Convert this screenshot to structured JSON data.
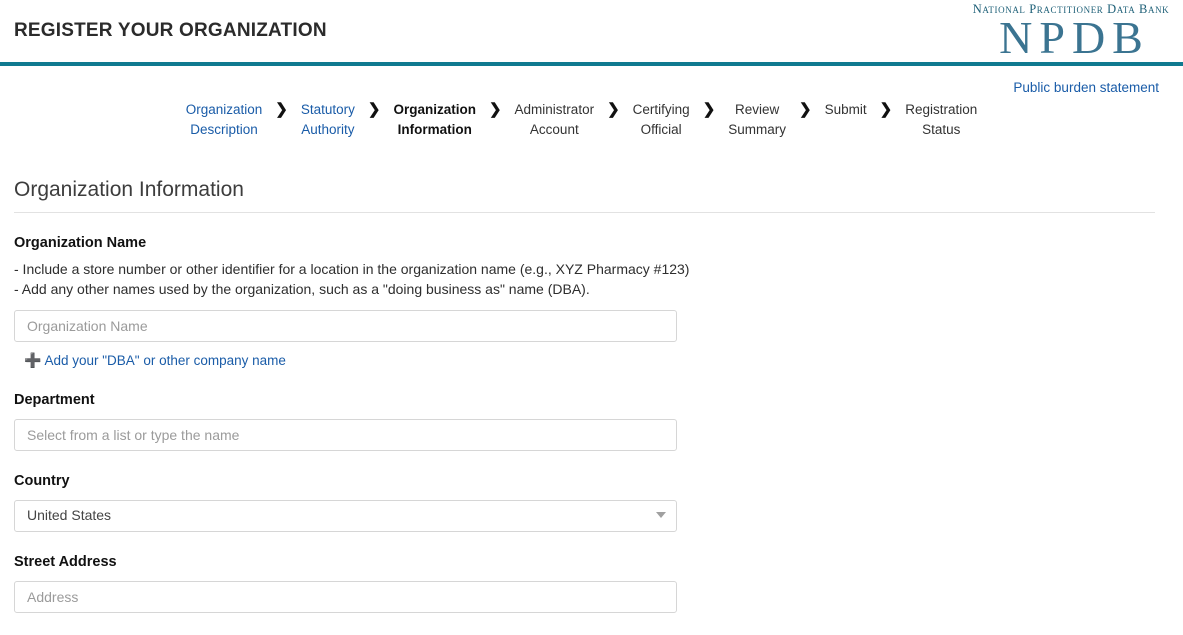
{
  "header": {
    "title": "REGISTER YOUR ORGANIZATION",
    "logo_caption": "National Practitioner Data Bank",
    "logo_mark": "NPDB",
    "accent_color": "#0f7a90",
    "logo_color": "#3b7491"
  },
  "burden": {
    "link_label": "Public burden statement"
  },
  "steps": {
    "separator": "❯",
    "items": [
      {
        "label": "Organization\nDescription",
        "state": "link"
      },
      {
        "label": "Statutory\nAuthority",
        "state": "link"
      },
      {
        "label": "Organization\nInformation",
        "state": "current"
      },
      {
        "label": "Administrator\nAccount",
        "state": "plain"
      },
      {
        "label": "Certifying\nOfficial",
        "state": "plain"
      },
      {
        "label": "Review\nSummary",
        "state": "plain"
      },
      {
        "label": "Submit",
        "state": "plain"
      },
      {
        "label": "Registration\nStatus",
        "state": "plain"
      }
    ]
  },
  "form": {
    "page_title": "Organization Information",
    "organization_name": {
      "label": "Organization Name",
      "help_line_1": "- Include a store number or other identifier for a location in the organization name (e.g., XYZ Pharmacy #123)",
      "help_line_2": "- Add any other names used by the organization, such as a \"doing business as\" name (DBA).",
      "placeholder": "Organization Name",
      "value": "",
      "dba_link": "Add your \"DBA\" or other company name",
      "dba_icon": "plus-icon"
    },
    "department": {
      "label": "Department",
      "placeholder": "Select from a list or type the name",
      "value": ""
    },
    "country": {
      "label": "Country",
      "selected": "United States",
      "arrow_icon": "chevron-down-icon"
    },
    "street_address": {
      "label": "Street Address",
      "placeholder": "Address",
      "value": ""
    }
  }
}
